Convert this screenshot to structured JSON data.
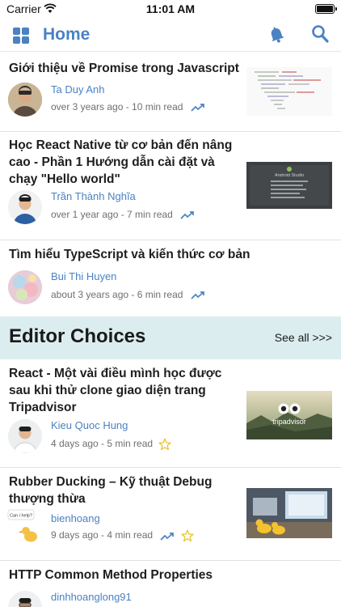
{
  "status": {
    "carrier": "Carrier",
    "time": "11:01 AM"
  },
  "nav": {
    "title": "Home",
    "menu_icon": "grid-icon",
    "notification_icon": "bell-icon",
    "search_icon": "search-icon",
    "accent": "#4a82c3"
  },
  "articles": [
    {
      "title": "Giới thiệu về Promise trong Javascript",
      "author": "Ta Duy Anh",
      "meta": "over 3 years ago - 10 min read",
      "trending": true,
      "editor_pick": false
    },
    {
      "title": "Học React Native từ cơ bản đến nâng cao - Phần 1 Hướng dẫn cài đặt và chạy \"Hello world\"",
      "author": "Trần Thành Nghĩa",
      "meta": "over 1 year ago - 7 min read",
      "trending": true,
      "editor_pick": false,
      "thumb_text": "Android Studio"
    },
    {
      "title": "Tìm hiểu TypeScript và kiến thức cơ bản",
      "author": "Bui Thi Huyen",
      "meta": "about 3 years ago - 6 min read",
      "trending": true,
      "editor_pick": false
    }
  ],
  "editor_choices": {
    "title": "Editor Choices",
    "see_all": "See all >>>",
    "background": "#dbedef",
    "items": [
      {
        "title": "React - Một vài điều mình học được sau khi thử clone giao diện trang Tripadvisor",
        "author": "Kieu Quoc Hung",
        "meta": "4 days ago - 5 min read",
        "trending": false,
        "editor_pick": true,
        "thumb_text": "tripadvisor"
      },
      {
        "title": "Rubber Ducking – Kỹ thuật Debug thượng thừa",
        "author": "bienhoang",
        "meta": "9 days ago - 4 min read",
        "trending": true,
        "editor_pick": true,
        "avatar_text": "Can i help?"
      },
      {
        "title": "HTTP Common Method Properties",
        "author": "dinhhoanglong91",
        "meta": "",
        "trending": false,
        "editor_pick": false
      }
    ]
  }
}
